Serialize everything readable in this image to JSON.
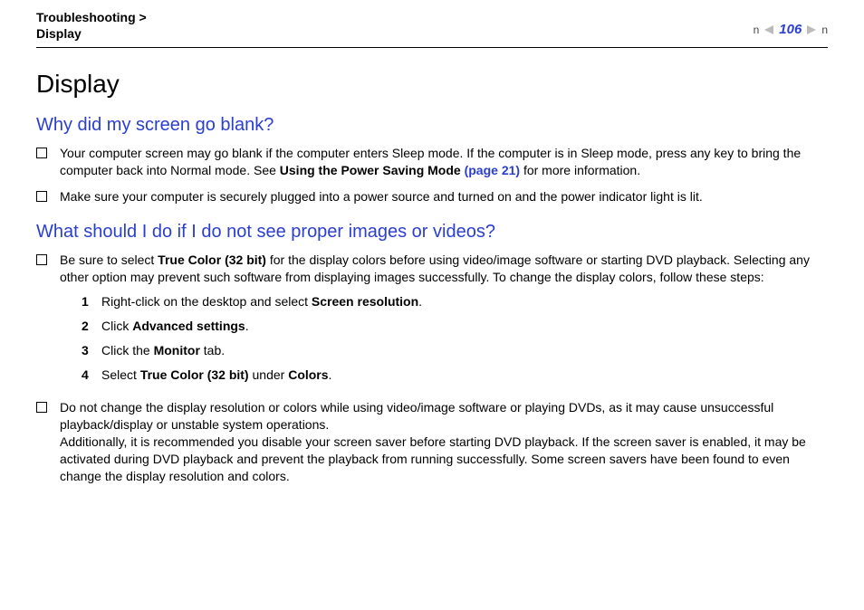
{
  "header": {
    "breadcrumb_parent": "Troubleshooting",
    "breadcrumb_sep": ">",
    "breadcrumb_current": "Display",
    "page_number": "106",
    "n_label": "n"
  },
  "title": "Display",
  "section1": {
    "heading": "Why did my screen go blank?",
    "items": [
      {
        "pre": "Your computer screen may go blank if the computer enters Sleep mode. If the computer is in Sleep mode, press any key to bring the computer back into Normal mode. See ",
        "bold1": "Using the Power Saving Mode ",
        "link": "(page 21)",
        "post": " for more information."
      },
      {
        "text": "Make sure your computer is securely plugged into a power source and turned on and the power indicator light is lit."
      }
    ]
  },
  "section2": {
    "heading": "What should I do if I do not see proper images or videos?",
    "item1": {
      "pre": "Be sure to select ",
      "bold1": "True Color (32 bit)",
      "post": " for the display colors before using video/image software or starting DVD playback. Selecting any other option may prevent such software from displaying images successfully. To change the display colors, follow these steps:"
    },
    "steps": [
      {
        "n": "1",
        "pre": "Right-click on the desktop and select ",
        "b": "Screen resolution",
        "post": "."
      },
      {
        "n": "2",
        "pre": "Click ",
        "b": "Advanced settings",
        "post": "."
      },
      {
        "n": "3",
        "pre": "Click the ",
        "b": "Monitor",
        "post": " tab."
      },
      {
        "n": "4",
        "pre": "Select ",
        "b": "True Color (32 bit)",
        "mid": " under ",
        "b2": "Colors",
        "post": "."
      }
    ],
    "item2": {
      "text": "Do not change the display resolution or colors while using video/image software or playing DVDs, as it may cause unsuccessful playback/display or unstable system operations.",
      "text2": "Additionally, it is recommended you disable your screen saver before starting DVD playback. If the screen saver is enabled, it may be activated during DVD playback and prevent the playback from running successfully. Some screen savers have been found to even change the display resolution and colors."
    }
  }
}
